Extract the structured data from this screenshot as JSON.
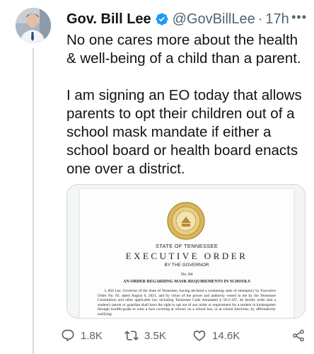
{
  "tweet": {
    "author_name": "Gov. Bill Lee",
    "handle": "@GovBillLee",
    "separator": "·",
    "time": "17h",
    "more": "•••",
    "paragraphs": [
      "No one cares more about the health & well-being of a child than a parent.",
      "I am signing an EO today that allows parents to opt their children out of a school mask mandate if either a school board or health board enacts one over a district."
    ]
  },
  "document": {
    "state": "STATE OF TENNESSEE",
    "title": "EXECUTIVE ORDER",
    "subtitle": "BY THE GOVERNOR",
    "number": "No. 84",
    "heading": "AN ORDER REGARDING MASK REQUIREMENTS IN SCHOOLS",
    "paragraph": "I, Bill Lee, Governor of the State of Tennessee, having declared a continuing state of emergency by Executive Order No. 83, dated August 6, 2021, and by virtue of the power and authority vested in me by the Tennessee Constitution and other applicable law including Tennessee Code Annotated § 58-2-107, do hereby order that a student's parent or guardian shall have the right to opt out of any order or requirement for a student in kindergarten through twelfth-grade to wear a face covering at school, on a school bus, or at school functions, by affirmatively notifying"
  },
  "actions": {
    "reply_count": "1.8K",
    "retweet_count": "3.5K",
    "like_count": "14.6K"
  },
  "icons": {
    "verified": "verified-badge-icon",
    "reply": "reply-icon",
    "retweet": "retweet-icon",
    "like": "heart-icon",
    "share": "share-icon"
  },
  "colors": {
    "text": "#0f1419",
    "muted": "#536471",
    "verified": "#1d9bf0",
    "border": "#cfd9de"
  }
}
